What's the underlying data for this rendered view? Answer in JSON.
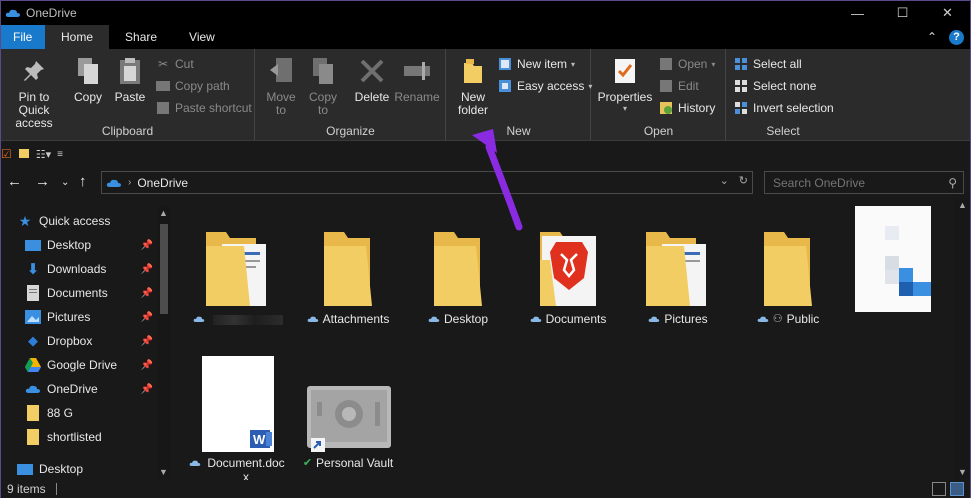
{
  "window": {
    "title": "OneDrive",
    "controls": [
      "—",
      "☐",
      "✕"
    ]
  },
  "ribbon_tabs": [
    {
      "label": "File"
    },
    {
      "label": "Home"
    },
    {
      "label": "Share"
    },
    {
      "label": "View"
    }
  ],
  "ribbon": {
    "clipboard": {
      "label": "Clipboard",
      "pin": "Pin to Quick access",
      "copy": "Copy",
      "paste": "Paste",
      "cut": "Cut",
      "copy_path": "Copy path",
      "paste_shortcut": "Paste shortcut"
    },
    "organize": {
      "label": "Organize",
      "move_to": "Move to",
      "copy_to": "Copy to",
      "delete": "Delete",
      "rename": "Rename"
    },
    "new": {
      "label": "New",
      "new_folder": "New folder",
      "new_item": "New item",
      "easy_access": "Easy access"
    },
    "open": {
      "label": "Open",
      "properties": "Properties",
      "open": "Open",
      "edit": "Edit",
      "history": "History"
    },
    "select": {
      "label": "Select",
      "select_all": "Select all",
      "select_none": "Select none",
      "invert": "Invert selection"
    }
  },
  "address": {
    "crumb": "OneDrive",
    "search_placeholder": "Search OneDrive"
  },
  "nav_pane": [
    {
      "label": "Quick access",
      "icon": "star-icon",
      "pinned": false
    },
    {
      "label": "Desktop",
      "icon": "desktop-icon",
      "pinned": true
    },
    {
      "label": "Downloads",
      "icon": "download-icon",
      "pinned": true
    },
    {
      "label": "Documents",
      "icon": "documents-icon",
      "pinned": true
    },
    {
      "label": "Pictures",
      "icon": "pictures-icon",
      "pinned": true
    },
    {
      "label": "Dropbox",
      "icon": "dropbox-icon",
      "pinned": true
    },
    {
      "label": "Google Drive",
      "icon": "google-drive-icon",
      "pinned": true
    },
    {
      "label": "OneDrive",
      "icon": "onedrive-icon",
      "pinned": true
    },
    {
      "label": "88 G",
      "icon": "folder-icon",
      "pinned": false
    },
    {
      "label": "shortlisted",
      "icon": "folder-icon",
      "pinned": false
    },
    {
      "label": "Desktop",
      "icon": "desktop-icon",
      "pinned": false
    }
  ],
  "files": [
    {
      "label": "",
      "kind": "folder-docs"
    },
    {
      "label": "Attachments",
      "kind": "folder"
    },
    {
      "label": "Desktop",
      "kind": "folder"
    },
    {
      "label": "Documents",
      "kind": "folder-brave"
    },
    {
      "label": "Pictures",
      "kind": "folder-docs"
    },
    {
      "label": "Public",
      "kind": "folder"
    },
    {
      "label": "",
      "kind": "blank"
    },
    {
      "label": "Document.docx",
      "kind": "word-doc"
    },
    {
      "label": "Personal Vault",
      "kind": "vault"
    }
  ],
  "status": {
    "count": "9 items"
  },
  "colors": {
    "accent": "#1979ca",
    "folder": "#f2cd63",
    "annotation": "#8a2be2"
  }
}
